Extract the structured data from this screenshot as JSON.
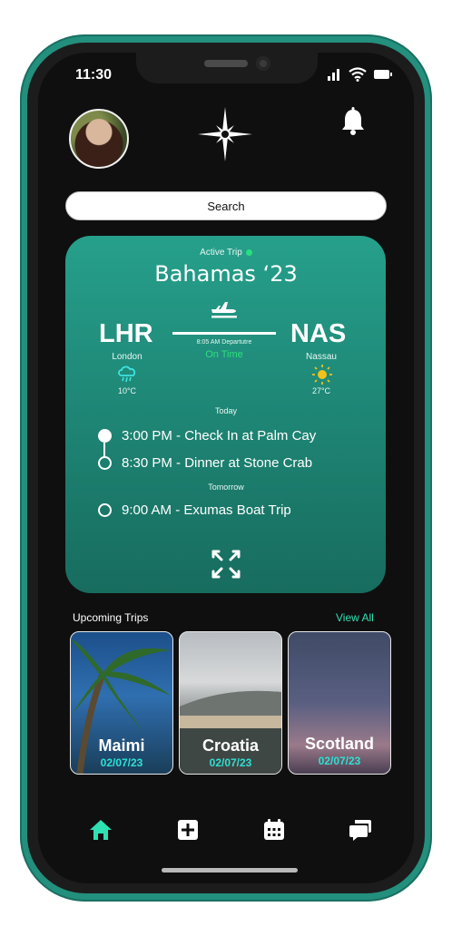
{
  "status_bar": {
    "time": "11:30"
  },
  "header": {
    "search_label": "Search"
  },
  "active_trip": {
    "label": "Active Trip",
    "title": "Bahamas ‘23",
    "origin": {
      "code": "LHR",
      "city": "London",
      "temp": "10°C",
      "weather_icon": "rain-cloud-icon"
    },
    "destination": {
      "code": "NAS",
      "city": "Nassau",
      "temp": "27°C",
      "weather_icon": "sun-icon"
    },
    "departure": "8:05 AM Departutre",
    "status": "On Time",
    "today_label": "Today",
    "today_events": [
      "3:00 PM - Check In at Palm Cay",
      "8:30 PM - Dinner at Stone Crab"
    ],
    "tomorrow_label": "Tomorrow",
    "tomorrow_events": [
      "9:00 AM - Exumas Boat Trip"
    ]
  },
  "upcoming": {
    "title": "Upcoming Trips",
    "view_all": "View All",
    "trips": [
      {
        "name": "Maimi",
        "date": "02/07/23"
      },
      {
        "name": "Croatia",
        "date": "02/07/23"
      },
      {
        "name": "Scotland",
        "date": "02/07/23"
      }
    ]
  },
  "tab_bar": [
    "home-icon",
    "add-icon",
    "calendar-icon",
    "chat-icon"
  ],
  "colors": {
    "accent": "#2ee0b2",
    "card": "#1f8877",
    "shell": "#23907e",
    "on_time": "#2ee07e"
  }
}
